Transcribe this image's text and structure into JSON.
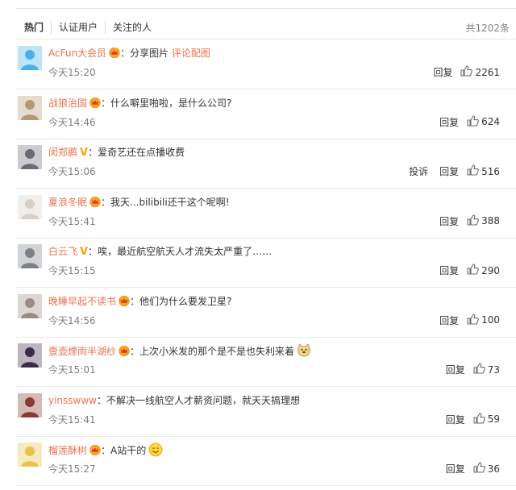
{
  "tabs": [
    "热门",
    "认证用户",
    "关注的人"
  ],
  "total": "共1202条",
  "comments": [
    {
      "user": "AcFun大会员",
      "badge": "vip-crown-icon",
      "verified": false,
      "text": "分享图片",
      "link": "评论配图",
      "time": "今天15:20",
      "report": "",
      "reply": "回复",
      "likes": "2261",
      "emoji": "",
      "avatar_color": "#4ab0e8"
    },
    {
      "user": "战狼治国",
      "badge": "vip-crown-icon",
      "verified": false,
      "text": "什么噼里啪啦，是什么公司?",
      "link": "",
      "time": "今天14:46",
      "report": "",
      "reply": "回复",
      "likes": "624",
      "emoji": "",
      "avatar_color": "#b69876"
    },
    {
      "user": "闵郑鹏",
      "badge": "",
      "verified": true,
      "text": "爱奇艺还在点播收费",
      "link": "",
      "time": "今天15:06",
      "report": "投诉",
      "reply": "回复",
      "likes": "516",
      "emoji": "",
      "avatar_color": "#6d6a78"
    },
    {
      "user": "夏浪冬眠",
      "badge": "vip-crown-icon",
      "verified": false,
      "text": "我天...bilibili还干这个呢啊!",
      "link": "",
      "time": "今天15:41",
      "report": "",
      "reply": "回复",
      "likes": "388",
      "emoji": "",
      "avatar_color": "#d8cfc8"
    },
    {
      "user": "白云飞",
      "badge": "",
      "verified": true,
      "text": "唉，最近航空航天人才流失太严重了……",
      "link": "",
      "time": "今天15:15",
      "report": "",
      "reply": "回复",
      "likes": "290",
      "emoji": "",
      "avatar_color": "#7c8087"
    },
    {
      "user": "晚睡早起不读书",
      "badge": "vip-crown-icon",
      "verified": false,
      "text": "他们为什么要发卫星?",
      "link": "",
      "time": "今天14:56",
      "report": "",
      "reply": "回复",
      "likes": "100",
      "emoji": "",
      "avatar_color": "#9a8c84"
    },
    {
      "user": "壹壶煙雨半湖纱",
      "badge": "vip-crown-icon",
      "verified": false,
      "text": "上次小米发的那个是不是也失利来着",
      "link": "",
      "time": "今天15:01",
      "report": "",
      "reply": "回复",
      "likes": "73",
      "emoji": "doge-emoji-icon",
      "avatar_color": "#3b2d4a"
    },
    {
      "user": "yinsswww",
      "badge": "",
      "verified": false,
      "text": "不解决一线航空人才薪资问题，就天天搞理想",
      "link": "",
      "time": "今天15:41",
      "report": "",
      "reply": "回复",
      "likes": "59",
      "emoji": "",
      "avatar_color": "#8a3a35"
    },
    {
      "user": "榴莲酥树",
      "badge": "vip-crown-icon",
      "verified": false,
      "text": "A站干的",
      "link": "",
      "time": "今天15:27",
      "report": "",
      "reply": "回复",
      "likes": "36",
      "emoji": "smile-emoji-icon",
      "avatar_color": "#e9c44a"
    }
  ]
}
